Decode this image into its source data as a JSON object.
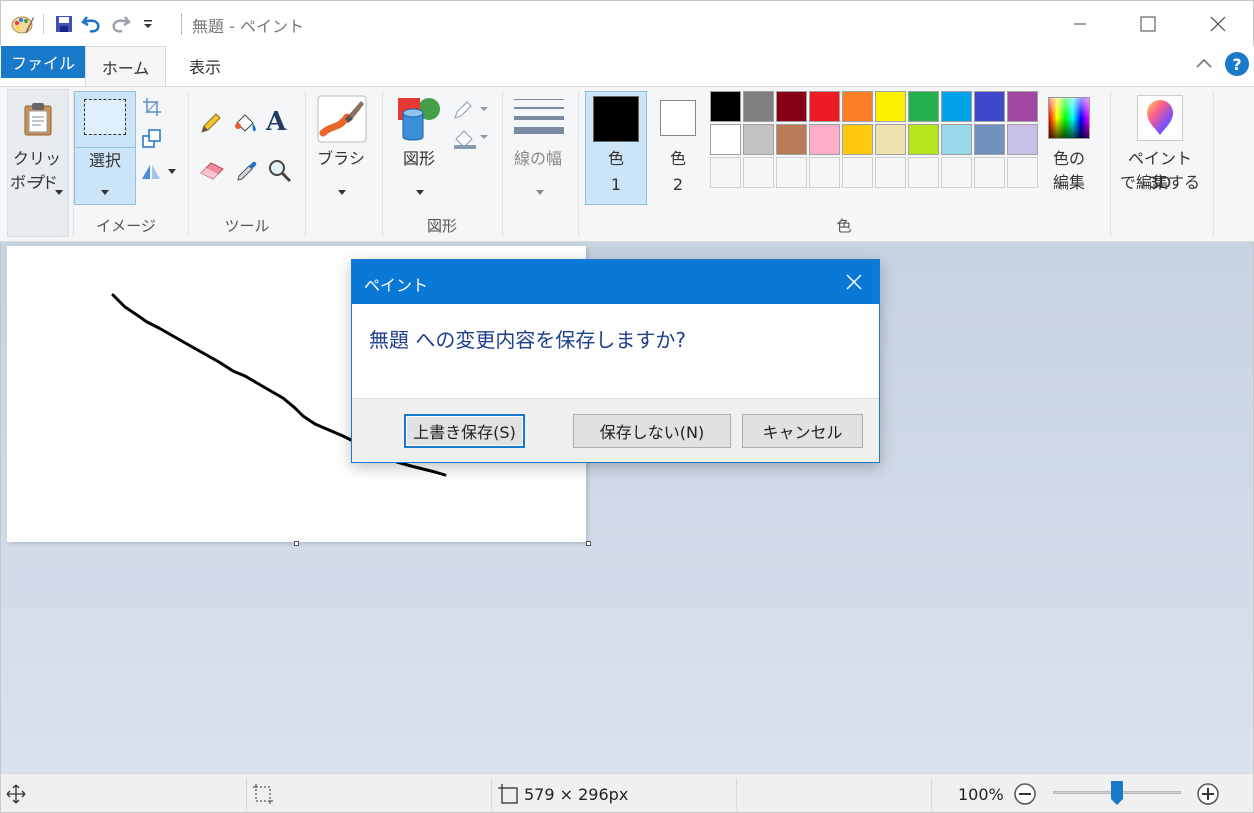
{
  "window": {
    "title": "無題 - ペイント",
    "controls": {
      "minimize": "minimize",
      "maximize": "maximize",
      "close": "close"
    }
  },
  "tabs": [
    {
      "label": "ファイル",
      "active": false
    },
    {
      "label": "ホーム",
      "active": true
    },
    {
      "label": "表示",
      "active": false
    }
  ],
  "ribbon": {
    "clipboard": {
      "label_line1": "クリップ",
      "label_line2": "ボード"
    },
    "image": {
      "select_label": "選択",
      "group_label": "イメージ"
    },
    "tools": {
      "group_label": "ツール"
    },
    "brushes": {
      "label": "ブラシ"
    },
    "shapes": {
      "label": "図形",
      "group_label": "図形"
    },
    "size": {
      "label": "線の幅"
    },
    "colors": {
      "color1_label": "色",
      "color1_num": "1",
      "color2_label": "色",
      "color2_num": "2",
      "edit_line1": "色の",
      "edit_line2": "編集",
      "group_label": "色",
      "color1": "#000000",
      "color2": "#ffffff",
      "palette_row1": [
        "#000000",
        "#7f7f7f",
        "#880015",
        "#ed1c24",
        "#ff7f27",
        "#fff200",
        "#22b14c",
        "#00a2e8",
        "#3f48cc",
        "#a349a4"
      ],
      "palette_row2": [
        "#ffffff",
        "#c3c3c3",
        "#b97a57",
        "#ffaec9",
        "#ffc90e",
        "#efe4b0",
        "#b5e61d",
        "#99d9ea",
        "#7092be",
        "#c8bfe7"
      ]
    },
    "paint3d": {
      "line1": "ペイント 3D",
      "line2": "で編集する"
    }
  },
  "status": {
    "canvas_size": "579 × 296px",
    "zoom": "100%",
    "zoom_value": 100
  },
  "dialog": {
    "title": "ペイント",
    "message": "無題 への変更内容を保存しますか?",
    "buttons": {
      "save": "上書き保存(S)",
      "dont_save": "保存しない(N)",
      "cancel": "キャンセル"
    }
  }
}
